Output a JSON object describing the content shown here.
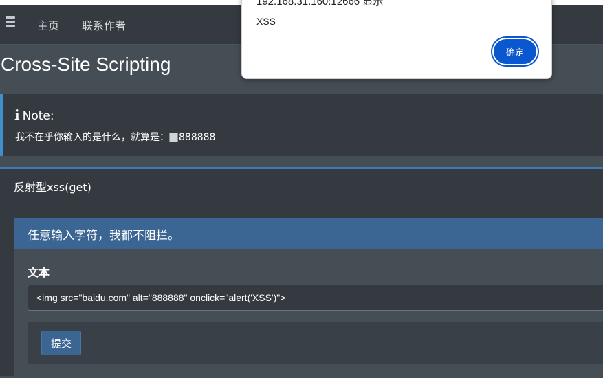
{
  "navbar": {
    "menu_icon": "hamburger-icon",
    "links": [
      "主页",
      "联系作者"
    ]
  },
  "page_title": "Cross-Site Scripting",
  "note": {
    "icon": "info-icon",
    "title": "Note:",
    "text_prefix": "我不在乎你输入的是什么，就算是：",
    "img_alt": "888888"
  },
  "card": {
    "title": "反射型xss(get)",
    "inner_title": "任意输入字符，我都不阻拦。",
    "field_label": "文本",
    "input_value": "<img src=\"baidu.com\" alt=\"888888\" onclick=\"alert('XSS')\">",
    "submit_label": "提交"
  },
  "dialog": {
    "origin": "192.168.31.160:12666 显示",
    "message": "XSS",
    "ok_label": "确定"
  },
  "colors": {
    "accent": "#3b6592",
    "callout_border": "#3f8fcf",
    "dialog_button": "#0b57d0"
  }
}
